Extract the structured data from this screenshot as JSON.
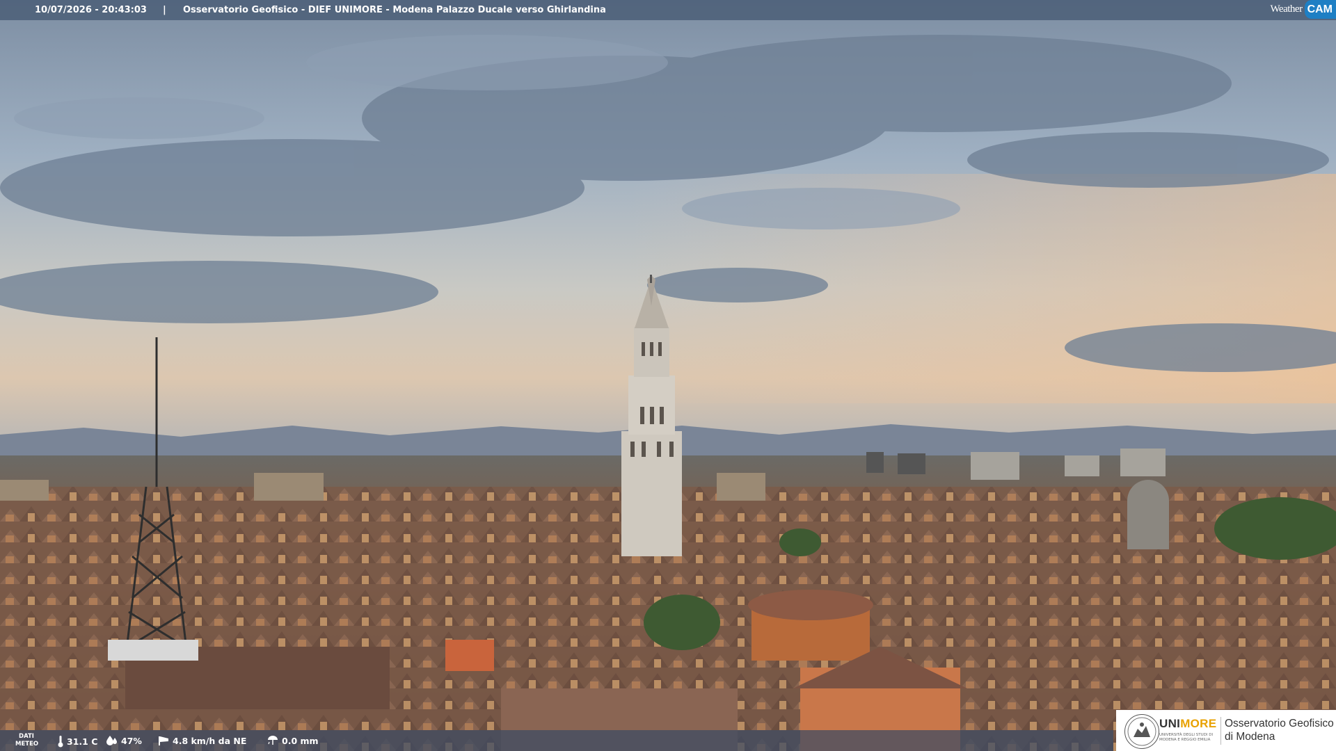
{
  "header": {
    "timestamp": "10/07/2026 - 20:43:03",
    "separator": "|",
    "title": "Osservatorio Geofisico - DIEF UNIMORE - Modena Palazzo Ducale verso Ghirlandina"
  },
  "brand": {
    "weather": "Weather",
    "cam": "CAM",
    "accent": "#1e7fc4"
  },
  "weather": {
    "label_line1": "DATI",
    "label_line2": "METEO",
    "temperature": "31.1 C",
    "humidity": "47%",
    "wind": "4.8 km/h da NE",
    "rain": "0.0 mm",
    "icons": [
      "thermometer-icon",
      "humidity-drop-icon",
      "wind-sock-icon",
      "rain-gauge-icon"
    ]
  },
  "logo": {
    "uni": "UNI",
    "more": "MORE",
    "subtitle": "UNIVERSITÀ DEGLI STUDI DI MODENA E REGGIO EMILIA",
    "observatory_line1": "Osservatorio Geofisico",
    "observatory_line2": "di Modena"
  }
}
